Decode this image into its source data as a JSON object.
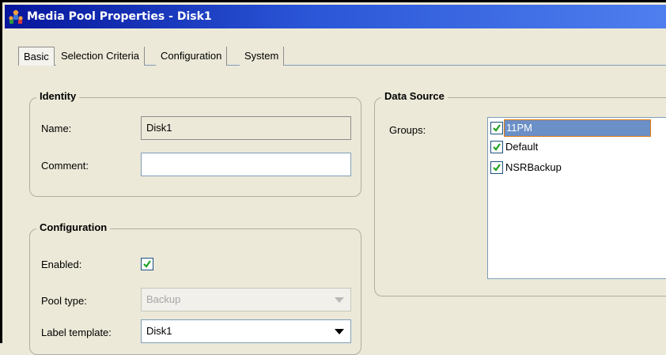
{
  "window": {
    "title": "Media Pool Properties - Disk1"
  },
  "tabs": [
    {
      "label": "Basic",
      "active": true
    },
    {
      "label": "Selection Criteria",
      "active": false
    },
    {
      "label": "Configuration",
      "active": false
    },
    {
      "label": "System",
      "active": false
    }
  ],
  "identity": {
    "title": "Identity",
    "name_label": "Name:",
    "name_value": "Disk1",
    "comment_label": "Comment:",
    "comment_value": ""
  },
  "configuration": {
    "title": "Configuration",
    "enabled_label": "Enabled:",
    "enabled_checked": true,
    "pool_type_label": "Pool type:",
    "pool_type_value": "Backup",
    "label_template_label": "Label template:",
    "label_template_value": "Disk1"
  },
  "data_source": {
    "title": "Data Source",
    "groups_label": "Groups:",
    "groups": [
      {
        "label": "11PM",
        "checked": true,
        "selected": true
      },
      {
        "label": "Default",
        "checked": true,
        "selected": false
      },
      {
        "label": "NSRBackup",
        "checked": true,
        "selected": false
      }
    ]
  },
  "colors": {
    "title_bar": "#2a55d6",
    "dialog_bg": "#ece9d8",
    "check_mark": "#21a121",
    "selection": "#6b8fc7"
  }
}
